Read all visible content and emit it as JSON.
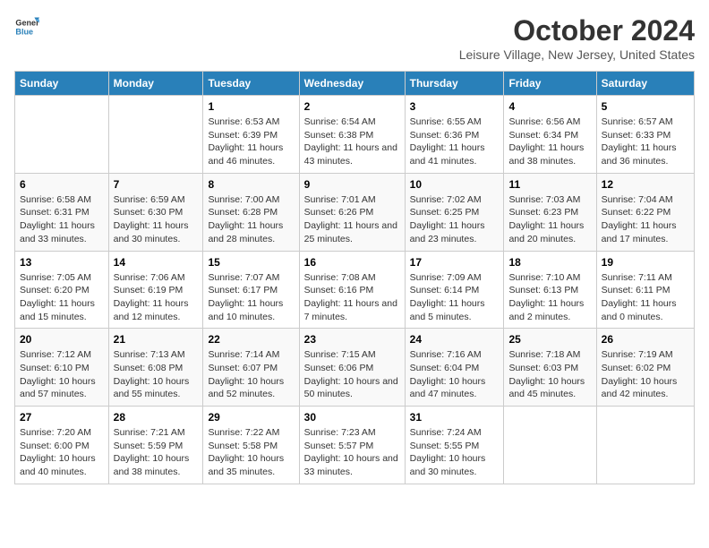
{
  "header": {
    "month": "October 2024",
    "location": "Leisure Village, New Jersey, United States",
    "logo_line1": "General",
    "logo_line2": "Blue"
  },
  "days_of_week": [
    "Sunday",
    "Monday",
    "Tuesday",
    "Wednesday",
    "Thursday",
    "Friday",
    "Saturday"
  ],
  "weeks": [
    {
      "cells": [
        {
          "day": "",
          "info": ""
        },
        {
          "day": "",
          "info": ""
        },
        {
          "day": "1",
          "info": "Sunrise: 6:53 AM\nSunset: 6:39 PM\nDaylight: 11 hours and 46 minutes."
        },
        {
          "day": "2",
          "info": "Sunrise: 6:54 AM\nSunset: 6:38 PM\nDaylight: 11 hours and 43 minutes."
        },
        {
          "day": "3",
          "info": "Sunrise: 6:55 AM\nSunset: 6:36 PM\nDaylight: 11 hours and 41 minutes."
        },
        {
          "day": "4",
          "info": "Sunrise: 6:56 AM\nSunset: 6:34 PM\nDaylight: 11 hours and 38 minutes."
        },
        {
          "day": "5",
          "info": "Sunrise: 6:57 AM\nSunset: 6:33 PM\nDaylight: 11 hours and 36 minutes."
        }
      ]
    },
    {
      "cells": [
        {
          "day": "6",
          "info": "Sunrise: 6:58 AM\nSunset: 6:31 PM\nDaylight: 11 hours and 33 minutes."
        },
        {
          "day": "7",
          "info": "Sunrise: 6:59 AM\nSunset: 6:30 PM\nDaylight: 11 hours and 30 minutes."
        },
        {
          "day": "8",
          "info": "Sunrise: 7:00 AM\nSunset: 6:28 PM\nDaylight: 11 hours and 28 minutes."
        },
        {
          "day": "9",
          "info": "Sunrise: 7:01 AM\nSunset: 6:26 PM\nDaylight: 11 hours and 25 minutes."
        },
        {
          "day": "10",
          "info": "Sunrise: 7:02 AM\nSunset: 6:25 PM\nDaylight: 11 hours and 23 minutes."
        },
        {
          "day": "11",
          "info": "Sunrise: 7:03 AM\nSunset: 6:23 PM\nDaylight: 11 hours and 20 minutes."
        },
        {
          "day": "12",
          "info": "Sunrise: 7:04 AM\nSunset: 6:22 PM\nDaylight: 11 hours and 17 minutes."
        }
      ]
    },
    {
      "cells": [
        {
          "day": "13",
          "info": "Sunrise: 7:05 AM\nSunset: 6:20 PM\nDaylight: 11 hours and 15 minutes."
        },
        {
          "day": "14",
          "info": "Sunrise: 7:06 AM\nSunset: 6:19 PM\nDaylight: 11 hours and 12 minutes."
        },
        {
          "day": "15",
          "info": "Sunrise: 7:07 AM\nSunset: 6:17 PM\nDaylight: 11 hours and 10 minutes."
        },
        {
          "day": "16",
          "info": "Sunrise: 7:08 AM\nSunset: 6:16 PM\nDaylight: 11 hours and 7 minutes."
        },
        {
          "day": "17",
          "info": "Sunrise: 7:09 AM\nSunset: 6:14 PM\nDaylight: 11 hours and 5 minutes."
        },
        {
          "day": "18",
          "info": "Sunrise: 7:10 AM\nSunset: 6:13 PM\nDaylight: 11 hours and 2 minutes."
        },
        {
          "day": "19",
          "info": "Sunrise: 7:11 AM\nSunset: 6:11 PM\nDaylight: 11 hours and 0 minutes."
        }
      ]
    },
    {
      "cells": [
        {
          "day": "20",
          "info": "Sunrise: 7:12 AM\nSunset: 6:10 PM\nDaylight: 10 hours and 57 minutes."
        },
        {
          "day": "21",
          "info": "Sunrise: 7:13 AM\nSunset: 6:08 PM\nDaylight: 10 hours and 55 minutes."
        },
        {
          "day": "22",
          "info": "Sunrise: 7:14 AM\nSunset: 6:07 PM\nDaylight: 10 hours and 52 minutes."
        },
        {
          "day": "23",
          "info": "Sunrise: 7:15 AM\nSunset: 6:06 PM\nDaylight: 10 hours and 50 minutes."
        },
        {
          "day": "24",
          "info": "Sunrise: 7:16 AM\nSunset: 6:04 PM\nDaylight: 10 hours and 47 minutes."
        },
        {
          "day": "25",
          "info": "Sunrise: 7:18 AM\nSunset: 6:03 PM\nDaylight: 10 hours and 45 minutes."
        },
        {
          "day": "26",
          "info": "Sunrise: 7:19 AM\nSunset: 6:02 PM\nDaylight: 10 hours and 42 minutes."
        }
      ]
    },
    {
      "cells": [
        {
          "day": "27",
          "info": "Sunrise: 7:20 AM\nSunset: 6:00 PM\nDaylight: 10 hours and 40 minutes."
        },
        {
          "day": "28",
          "info": "Sunrise: 7:21 AM\nSunset: 5:59 PM\nDaylight: 10 hours and 38 minutes."
        },
        {
          "day": "29",
          "info": "Sunrise: 7:22 AM\nSunset: 5:58 PM\nDaylight: 10 hours and 35 minutes."
        },
        {
          "day": "30",
          "info": "Sunrise: 7:23 AM\nSunset: 5:57 PM\nDaylight: 10 hours and 33 minutes."
        },
        {
          "day": "31",
          "info": "Sunrise: 7:24 AM\nSunset: 5:55 PM\nDaylight: 10 hours and 30 minutes."
        },
        {
          "day": "",
          "info": ""
        },
        {
          "day": "",
          "info": ""
        }
      ]
    }
  ]
}
